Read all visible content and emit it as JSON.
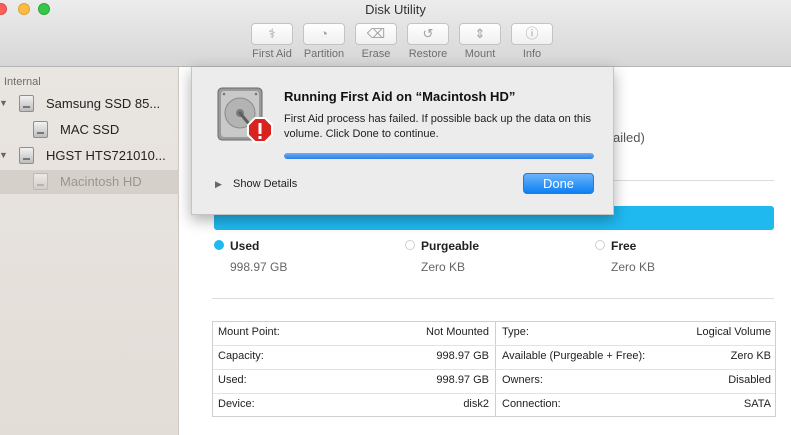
{
  "window": {
    "title": "Disk Utility"
  },
  "toolbar": {
    "items": [
      {
        "label": "First Aid",
        "icon": "stethoscope-icon",
        "glyph": "⚕"
      },
      {
        "label": "Partition",
        "icon": "pie-chart-icon",
        "glyph": "◔"
      },
      {
        "label": "Erase",
        "icon": "eraser-icon",
        "glyph": "⌫"
      },
      {
        "label": "Restore",
        "icon": "restore-icon",
        "glyph": "↺"
      },
      {
        "label": "Mount",
        "icon": "mount-icon",
        "glyph": "⇕"
      },
      {
        "label": "Info",
        "icon": "info-icon",
        "glyph": "ⓘ"
      }
    ]
  },
  "sidebar": {
    "section": "Internal",
    "items": [
      {
        "label": "Samsung SSD 85...",
        "type": "disk"
      },
      {
        "label": "MAC SSD",
        "type": "volume"
      },
      {
        "label": "HGST HTS721010...",
        "type": "disk"
      },
      {
        "label": "Macintosh HD",
        "type": "volume",
        "selected": true
      }
    ]
  },
  "main": {
    "background_text": "ailed)",
    "usage_color": "#1fb9f0",
    "legend": [
      {
        "name": "Used",
        "value": "998.97 GB",
        "color": "#1fb9f0"
      },
      {
        "name": "Purgeable",
        "value": "Zero KB",
        "color": "#e0e0e0"
      },
      {
        "name": "Free",
        "value": "Zero KB",
        "color": "#ffffff"
      }
    ],
    "info_rows": [
      {
        "left_label": "Mount Point:",
        "left_value": "Not Mounted",
        "right_label": "Type:",
        "right_value": "Logical Volume"
      },
      {
        "left_label": "Capacity:",
        "left_value": "998.97 GB",
        "right_label": "Available (Purgeable + Free):",
        "right_value": "Zero KB"
      },
      {
        "left_label": "Used:",
        "left_value": "998.97 GB",
        "right_label": "Owners:",
        "right_value": "Disabled"
      },
      {
        "left_label": "Device:",
        "left_value": "disk2",
        "right_label": "Connection:",
        "right_value": "SATA"
      }
    ]
  },
  "dialog": {
    "title": "Running First Aid on “Macintosh HD”",
    "message": "First Aid process has failed. If possible back up the data on this volume. Click Done to continue.",
    "progress": 1.0,
    "show_details_label": "Show Details",
    "done_label": "Done",
    "icon": "disk-error-icon"
  }
}
